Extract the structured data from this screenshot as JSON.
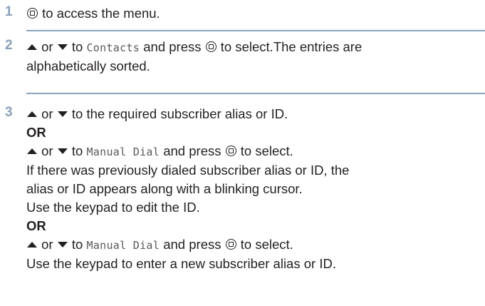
{
  "steps": [
    {
      "number": "1",
      "text": "to access the menu."
    },
    {
      "number": "2",
      "or": "or",
      "to": "to",
      "target": "Contacts",
      "press": "and press",
      "select": "to select.The entries are",
      "line2": "alphabetically sorted."
    },
    {
      "number": "3",
      "line1": {
        "or": "or",
        "rest": "to the required subscriber alias or ID."
      },
      "or_a": "OR",
      "line3": {
        "or": "or",
        "to": "to",
        "target": "Manual Dial",
        "press": "and press",
        "select": "to select."
      },
      "line4": "If there was previously dialed subscriber alias or ID, the",
      "line5": "alias or ID appears along with a blinking cursor.",
      "line6": "Use the keypad to edit the ID.",
      "or_b": "OR",
      "line8": {
        "or": "or",
        "to": "to",
        "target": "Manual Dial",
        "press": "and press",
        "select": "to select."
      },
      "line9": "Use the keypad to enter a new subscriber alias or ID."
    }
  ]
}
